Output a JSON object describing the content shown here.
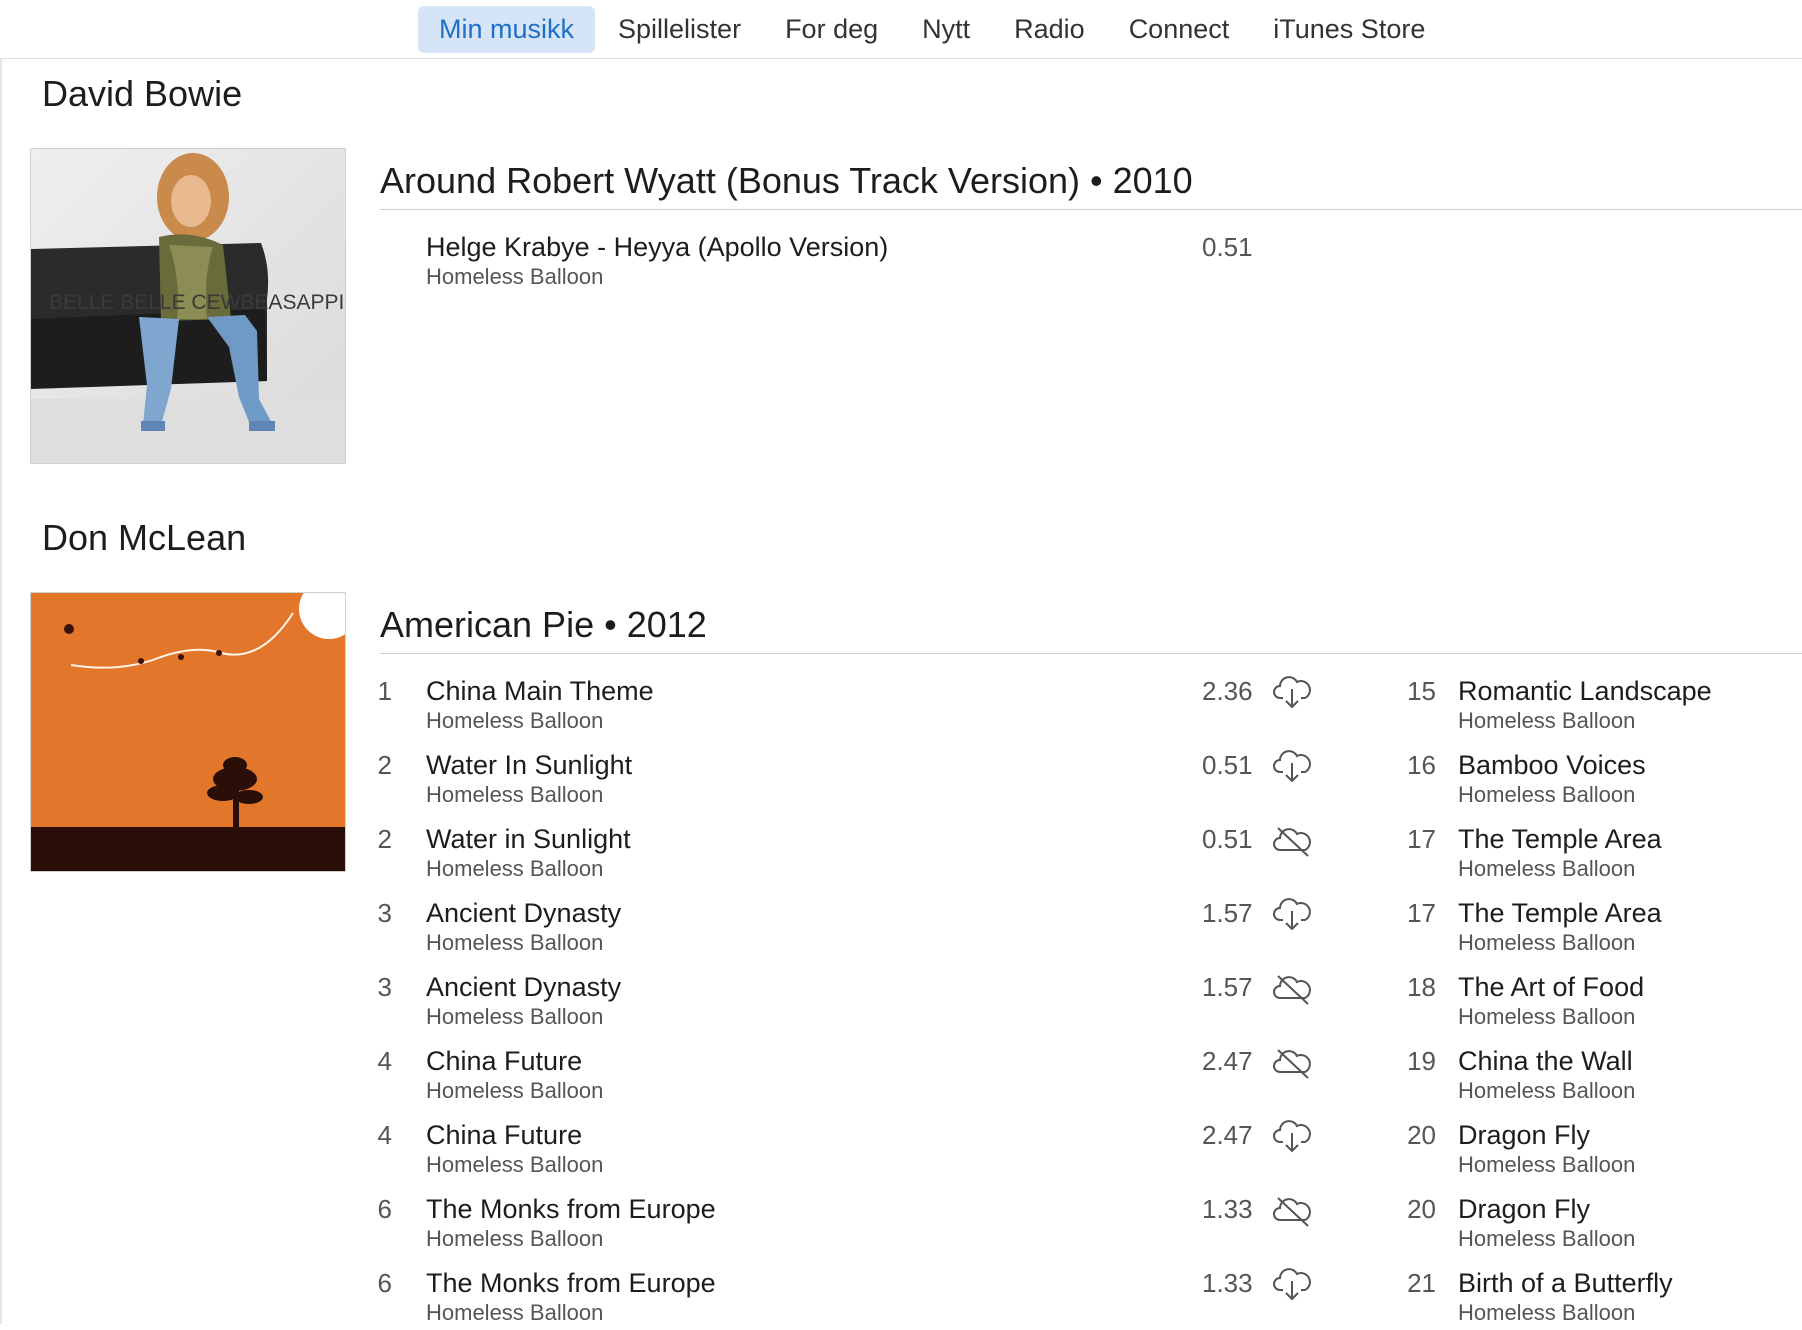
{
  "nav": {
    "tabs": [
      {
        "label": "Min musikk",
        "active": true
      },
      {
        "label": "Spillelister"
      },
      {
        "label": "For deg"
      },
      {
        "label": "Nytt"
      },
      {
        "label": "Radio"
      },
      {
        "label": "Connect"
      },
      {
        "label": "iTunes Store"
      }
    ]
  },
  "colors": {
    "accent": "#1f6fc7",
    "active_tab_bg": "#d5e5f7",
    "cover2_orange": "#e2772c",
    "cover2_ground": "#2a0f08"
  },
  "sections": [
    {
      "artist": "David Bowie",
      "album": {
        "title": "Around Robert Wyatt (Bonus Track Version) • 2010",
        "cover_text": "BELLE BELLE CEWBEASAPPIC",
        "tracks": [
          {
            "number": "",
            "name": "Helge Krabye - Heyya (Apollo Version)",
            "artist": "Homeless Balloon",
            "duration": "0.51",
            "icon": "none"
          }
        ]
      }
    },
    {
      "artist": "Don McLean",
      "album": {
        "title": "American Pie • 2012",
        "tracks_left": [
          {
            "number": "1",
            "name": "China Main Theme",
            "artist": "Homeless Balloon",
            "duration": "2.36",
            "icon": "cloud-download-icon"
          },
          {
            "number": "2",
            "name": "Water In Sunlight",
            "artist": "Homeless Balloon",
            "duration": "0.51",
            "icon": "cloud-download-icon"
          },
          {
            "number": "2",
            "name": "Water in Sunlight",
            "artist": "Homeless Balloon",
            "duration": "0.51",
            "icon": "cloud-unavailable-icon"
          },
          {
            "number": "3",
            "name": "Ancient Dynasty",
            "artist": "Homeless Balloon",
            "duration": "1.57",
            "icon": "cloud-download-icon"
          },
          {
            "number": "3",
            "name": "Ancient Dynasty",
            "artist": "Homeless Balloon",
            "duration": "1.57",
            "icon": "cloud-unavailable-icon"
          },
          {
            "number": "4",
            "name": "China Future",
            "artist": "Homeless Balloon",
            "duration": "2.47",
            "icon": "cloud-unavailable-icon"
          },
          {
            "number": "4",
            "name": "China Future",
            "artist": "Homeless Balloon",
            "duration": "2.47",
            "icon": "cloud-download-icon"
          },
          {
            "number": "6",
            "name": "The Monks from Europe",
            "artist": "Homeless Balloon",
            "duration": "1.33",
            "icon": "cloud-unavailable-icon"
          },
          {
            "number": "6",
            "name": "The Monks from Europe",
            "artist": "Homeless Balloon",
            "duration": "1.33",
            "icon": "cloud-download-icon"
          }
        ],
        "tracks_right": [
          {
            "number": "15",
            "name": "Romantic Landscape",
            "artist": "Homeless Balloon"
          },
          {
            "number": "16",
            "name": "Bamboo Voices",
            "artist": "Homeless Balloon"
          },
          {
            "number": "17",
            "name": "The Temple Area",
            "artist": "Homeless Balloon"
          },
          {
            "number": "17",
            "name": "The Temple Area",
            "artist": "Homeless Balloon"
          },
          {
            "number": "18",
            "name": "The Art of Food",
            "artist": "Homeless Balloon"
          },
          {
            "number": "19",
            "name": "China the Wall",
            "artist": "Homeless Balloon"
          },
          {
            "number": "20",
            "name": "Dragon Fly",
            "artist": "Homeless Balloon"
          },
          {
            "number": "20",
            "name": "Dragon Fly",
            "artist": "Homeless Balloon"
          },
          {
            "number": "21",
            "name": "Birth of a Butterfly",
            "artist": "Homeless Balloon"
          }
        ]
      }
    }
  ]
}
